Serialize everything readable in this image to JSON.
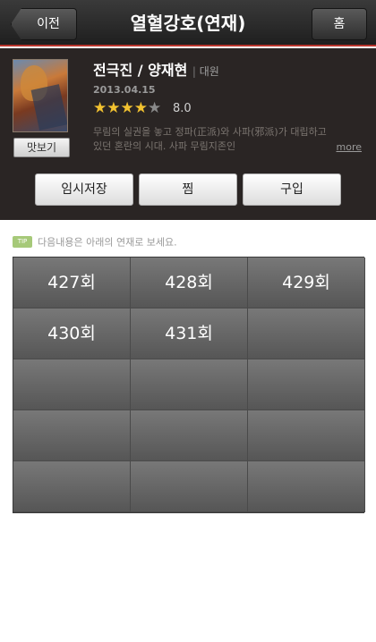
{
  "header": {
    "back_label": "이전",
    "title": "열혈강호(연재)",
    "home_label": "홈"
  },
  "book": {
    "author": "전극진 / 양재현",
    "publisher": "대원",
    "date": "2013.04.15",
    "rating": "8.0",
    "rating_stars": 4,
    "rating_max": 5,
    "description": "무림의 실권을 놓고 정파(正派)와 사파(邪派)가 대립하고 있던 혼란의 시대. 사파 무림지존인",
    "more_label": "more",
    "preview_label": "맛보기"
  },
  "actions": {
    "save_label": "임시저장",
    "fav_label": "찜",
    "buy_label": "구입"
  },
  "tip": {
    "badge": "TIP",
    "text": "다음내용은 아래의 연재로 보세요."
  },
  "episodes": [
    {
      "label": "427회"
    },
    {
      "label": "428회"
    },
    {
      "label": "429회"
    },
    {
      "label": "430회"
    },
    {
      "label": "431회"
    }
  ]
}
